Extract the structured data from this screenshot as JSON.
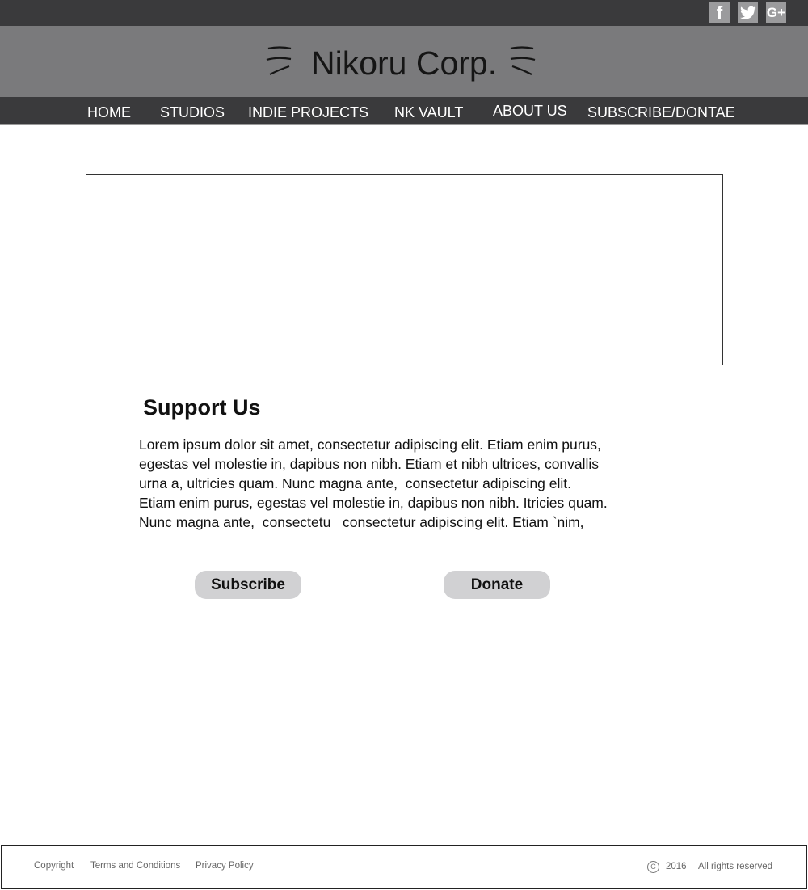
{
  "social": {
    "facebook_glyph": "f",
    "googleplus_glyph": "G+",
    "icons": [
      "facebook-icon",
      "twitter-icon",
      "google-plus-icon"
    ]
  },
  "brand": {
    "name": "Nikoru Corp."
  },
  "nav": {
    "items": [
      {
        "label": "HOME"
      },
      {
        "label": "STUDIOS"
      },
      {
        "label": "INDIE PROJECTS"
      },
      {
        "label": "NK VAULT"
      },
      {
        "label": "ABOUT US"
      },
      {
        "label": "SUBSCRIBE/DONTAE"
      }
    ]
  },
  "support": {
    "title": "Support Us",
    "lines": [
      "Lorem ipsum dolor sit amet, consectetur adipiscing elit. Etiam enim purus,",
      "egestas vel molestie in, dapibus non nibh. Etiam et nibh ultrices, convallis",
      "urna a, ultricies quam. Nunc magna ante,  consectetur adipiscing elit.",
      "Etiam enim purus, egestas vel molestie in, dapibus non nibh. Itricies quam.",
      "Nunc magna ante,  consectetu   consectetur adipiscing elit. Etiam `nim,"
    ],
    "subscribe_label": "Subscribe",
    "donate_label": "Donate"
  },
  "footer": {
    "copyright": "Copyright",
    "terms": "Terms and Conditions",
    "privacy": "Privacy Policy",
    "copy_symbol": "C",
    "year": "2016",
    "rights": "All rights reserved"
  },
  "colors": {
    "topbar": "#3a3a3c",
    "banner": "#7a7a7c",
    "button": "#d1d1d3",
    "social_bg": "#9b9b9d"
  }
}
